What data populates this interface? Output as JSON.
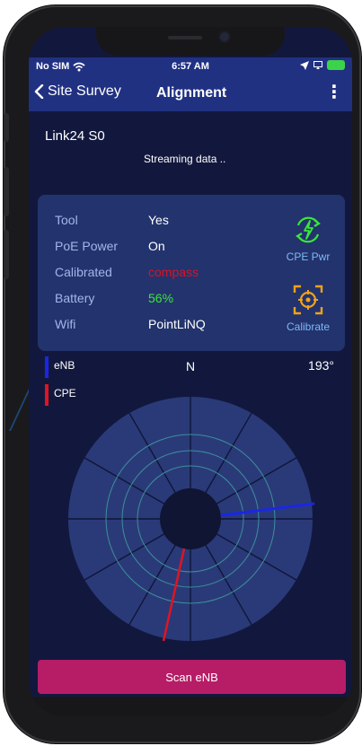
{
  "status_bar": {
    "carrier": "No SIM",
    "time": "6:57 AM"
  },
  "nav": {
    "back_label": "Site Survey",
    "title": "Alignment",
    "menu_glyph": "⋮"
  },
  "link": {
    "name": "Link24 S0",
    "stream_status": "Streaming data .."
  },
  "info": {
    "rows": [
      {
        "label": "Tool",
        "value": "Yes"
      },
      {
        "label": "PoE Power",
        "value": "On"
      },
      {
        "label": "Calibrated",
        "value": "compass",
        "color": "#dd1122"
      },
      {
        "label": "Battery",
        "value": "56%",
        "color": "#39e63a"
      },
      {
        "label": "Wifi",
        "value": "PointLiNQ"
      }
    ],
    "cpe_power_label": "CPE Pwr",
    "calibrate_label": "Calibrate"
  },
  "compass": {
    "north_label": "N",
    "heading": "193°",
    "legend": [
      {
        "label": "eNB",
        "color": "#1a26e6"
      },
      {
        "label": "CPE",
        "color": "#e01422"
      }
    ]
  },
  "actions": {
    "scan_label": "Scan eNB"
  },
  "colors": {
    "accent_green": "#39e63a",
    "accent_orange": "#f0a21a",
    "button": "#b61d66"
  },
  "icons": [
    "wifi-icon",
    "location-arrow-icon",
    "battery-icon",
    "back-chevron-icon",
    "menu-icon",
    "power-cycle-icon",
    "target-icon"
  ]
}
